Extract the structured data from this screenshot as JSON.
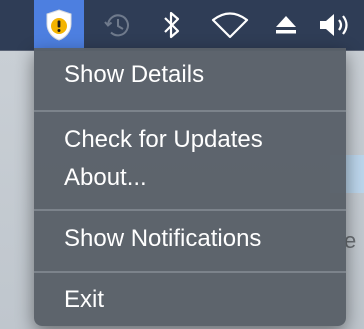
{
  "menubar": {
    "icons": [
      "shield-warning-icon",
      "time-machine-icon",
      "bluetooth-icon",
      "wifi-icon",
      "eject-icon",
      "volume-icon"
    ],
    "colors": {
      "bar": "#2f3d56",
      "active": "#4d7fe0",
      "shield": "#ffffff",
      "warning": "#f4b400"
    }
  },
  "menu": {
    "items": [
      {
        "label": "Show Details"
      },
      {
        "label": "Check for Updates"
      },
      {
        "label": "About..."
      },
      {
        "label": "Show Notifications"
      },
      {
        "label": "Exit"
      }
    ]
  },
  "background": {
    "partial_text": "e"
  }
}
